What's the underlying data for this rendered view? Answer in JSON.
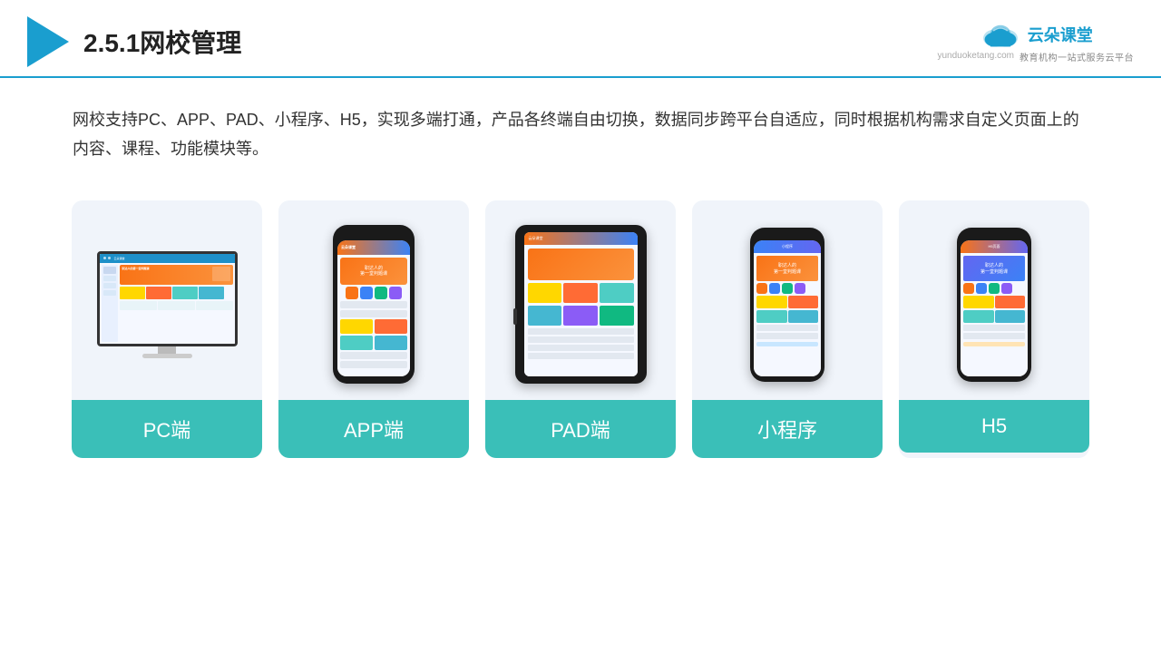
{
  "header": {
    "title": "2.5.1网校管理",
    "brand": {
      "name": "云朵课堂",
      "url": "yunduoketang.com",
      "tagline": "教育机构一站式服务云平台"
    }
  },
  "description": {
    "text": "网校支持PC、APP、PAD、小程序、H5，实现多端打通，产品各终端自由切换，数据同步跨平台自适应，同时根据机构需求自定义页面上的内容、课程、功能模块等。"
  },
  "cards": [
    {
      "id": "pc",
      "label": "PC端"
    },
    {
      "id": "app",
      "label": "APP端"
    },
    {
      "id": "pad",
      "label": "PAD端"
    },
    {
      "id": "miniprogram",
      "label": "小程序"
    },
    {
      "id": "h5",
      "label": "H5"
    }
  ],
  "colors": {
    "accent": "#1a9ecf",
    "teal": "#3abfb8",
    "orange": "#f97316",
    "blue": "#3b82f6"
  }
}
